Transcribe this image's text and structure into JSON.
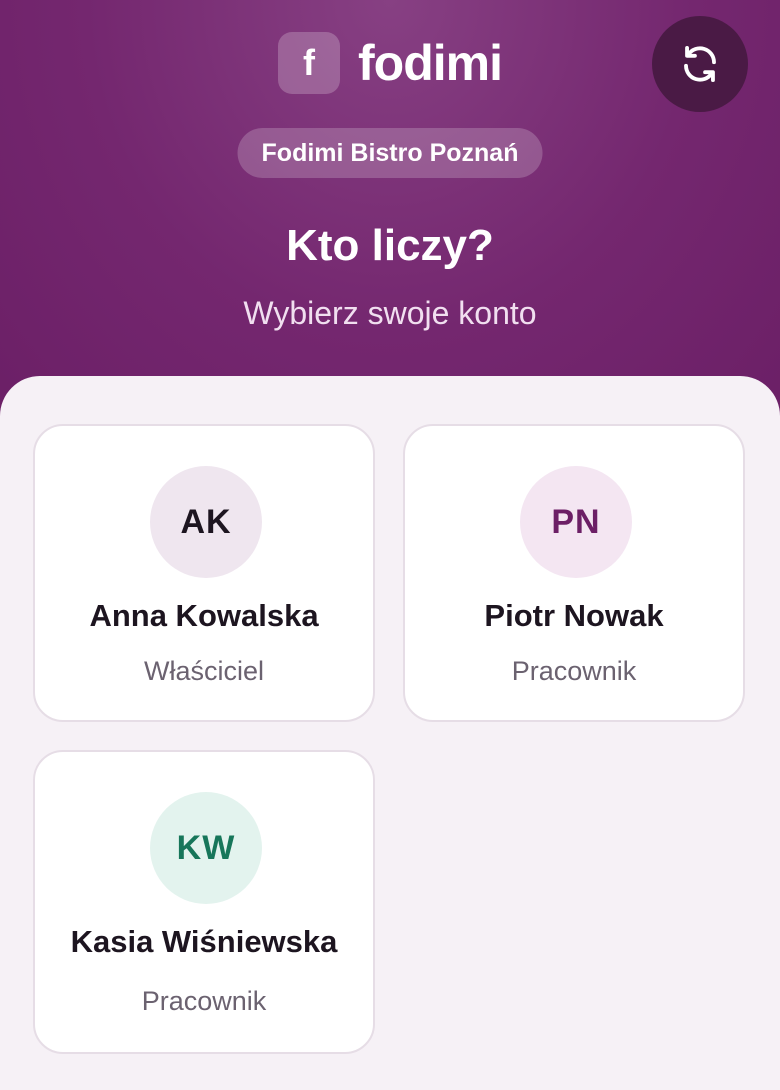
{
  "brand": {
    "logo_letter": "f",
    "name": "fodimi"
  },
  "header": {
    "refresh_icon": "refresh-icon",
    "location": "Fodimi Bistro Poznań",
    "title": "Kto liczy?",
    "subtitle": "Wybierz swoje konto"
  },
  "colors": {
    "header_bg": "#74276f",
    "refresh_bg": "#4a1a45",
    "panel_bg": "#f6f1f6",
    "card_border": "#e6dde6"
  },
  "users": [
    {
      "initials": "AK",
      "name": "Anna Kowalska",
      "role": "Właściciel",
      "avatar_bg": "#efe6ef",
      "avatar_fg": "#1d1520"
    },
    {
      "initials": "PN",
      "name": "Piotr Nowak",
      "role": "Pracownik",
      "avatar_bg": "#f4e6f2",
      "avatar_fg": "#6c1f66"
    },
    {
      "initials": "KW",
      "name": "Kasia Wiśniewska",
      "role": "Pracownik",
      "avatar_bg": "#e3f3ee",
      "avatar_fg": "#17765a"
    }
  ]
}
